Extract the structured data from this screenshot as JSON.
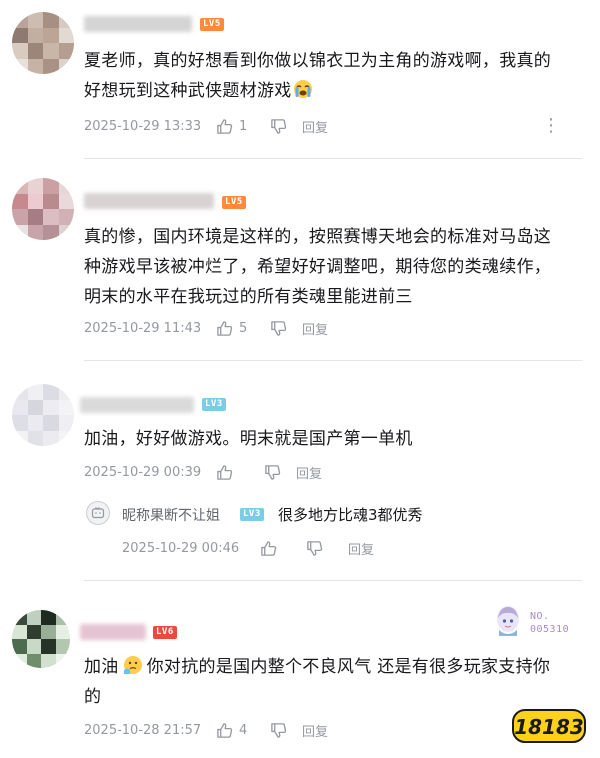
{
  "comments": [
    {
      "level": "LV5",
      "text_lines": [
        "夏老师，真的好想看到你做以锦衣卫为主角的游戏啊，我真的",
        "好想玩到这种武侠题材游戏"
      ],
      "emoji": "crying-face-icon",
      "time": "2025-10-29 13:33",
      "likes": "1",
      "reply_label": "回复",
      "more_label": "⋮"
    },
    {
      "level": "LV5",
      "text_lines": [
        "真的惨，国内环境是这样的，按照赛博天地会的标准对马岛这",
        "种游戏早该被冲烂了，希望好好调整吧，期待您的类魂续作，",
        "明末的水平在我玩过的所有类魂里能进前三"
      ],
      "time": "2025-10-29 11:43",
      "likes": "5",
      "reply_label": "回复"
    },
    {
      "level": "LV3",
      "text_lines": [
        "加油，好好做游戏。明末就是国产第一单机"
      ],
      "time": "2025-10-29 00:39",
      "likes": "",
      "reply_label": "回复",
      "sub_reply": {
        "username": "昵称果断不让姐",
        "level": "LV3",
        "text": "很多地方比魂3都优秀",
        "time": "2025-10-29 00:46",
        "reply_label": "回复"
      }
    },
    {
      "level": "LV6",
      "text_before_emoji": "加油",
      "text_after_emoji": "你对抗的是国内整个不良风气 还是有很多玩家支持你",
      "text_line2": "的",
      "emoji": "thinking-face-icon",
      "badge_number": "NO.",
      "badge_id": "005310",
      "time": "2025-10-28 21:57",
      "likes": "4",
      "reply_label": "回复"
    }
  ],
  "watermark": "18183",
  "colors": {
    "text": "#18191c",
    "meta": "#9499a0",
    "divider": "#e3e5e7",
    "lv5": "#ff8a3d",
    "lv3": "#7bcde7",
    "lv6": "#ee4a3a",
    "watermark_yellow": "#ffd21a"
  }
}
